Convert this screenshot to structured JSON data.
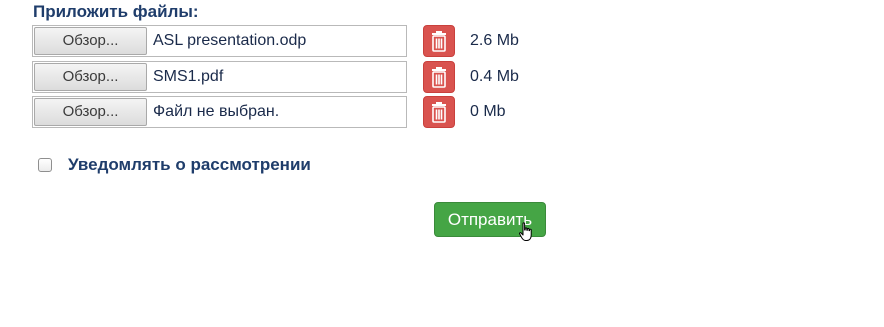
{
  "attach_section": {
    "title": "Приложить файлы:",
    "files": [
      {
        "browse_label": "Обзор...",
        "file_name": "ASL presentation.odp",
        "size": "2.6 Mb"
      },
      {
        "browse_label": "Обзор...",
        "file_name": "SMS1.pdf",
        "size": "0.4 Mb"
      },
      {
        "browse_label": "Обзор...",
        "file_name": "Файл не выбран.",
        "size": "0 Mb"
      }
    ]
  },
  "notify": {
    "label": "Уведомлять о рассмотрении",
    "checked": false
  },
  "submit": {
    "label": "Отправить"
  },
  "colors": {
    "delete": "#d9534f",
    "submit": "#45a545",
    "heading": "#1f3d6b"
  },
  "icons": {
    "delete": "trash-icon",
    "cursor": "hand-pointer-icon"
  }
}
